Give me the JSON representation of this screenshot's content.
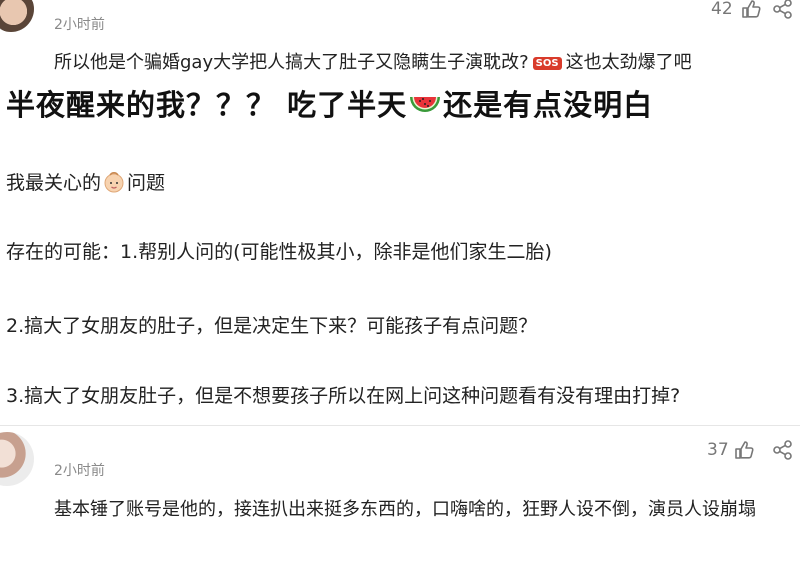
{
  "comment1": {
    "time": "2小时前",
    "likes": "42",
    "text_before_emoji": "所以他是个骗婚gay大学把人搞大了肚子又隐瞒生子演耽改?",
    "sos_badge": "SOS",
    "text_after_emoji": "这也太劲爆了吧"
  },
  "post": {
    "headline_part1": "半夜醒来的我？？？ 吃了半天",
    "headline_part2": "还是有点没明白",
    "line1_part1": "我最关心的",
    "line1_part2": "问题",
    "line2": "存在的可能：1.帮别人问的(可能性极其小，除非是他们家生二胎)",
    "line3": "2.搞大了女朋友的肚子，但是决定生下来？可能孩子有点问题？",
    "line4": "3.搞大了女朋友肚子，但是不想要孩子所以在网上问这种问题看有没有理由打掉?"
  },
  "comment2": {
    "time": "2小时前",
    "likes": "37",
    "text": "基本锤了账号是他的，接连扒出来挺多东西的，口嗨啥的，狂野人设不倒，演员人设崩塌"
  },
  "icons": [
    "thumbs-up-icon",
    "share-icon",
    "watermelon-icon",
    "baby-icon",
    "sos-icon"
  ]
}
